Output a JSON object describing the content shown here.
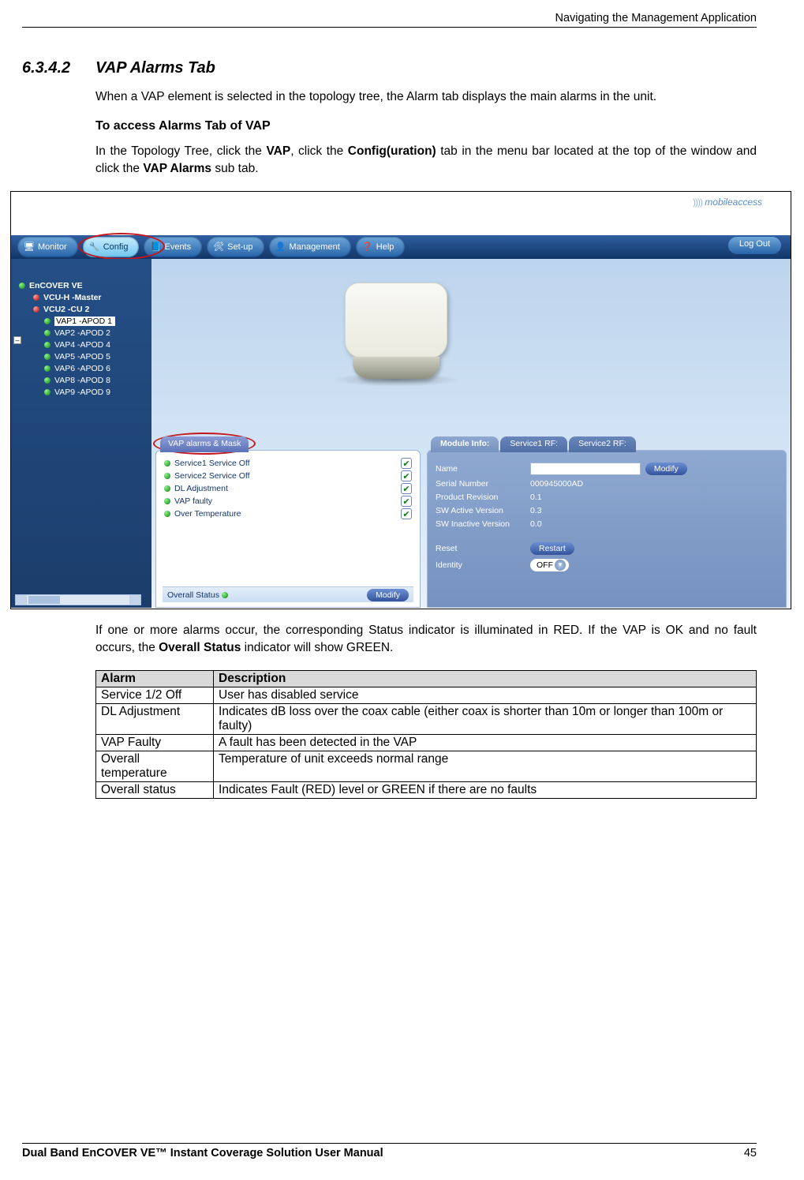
{
  "header": {
    "right": "Navigating the Management Application"
  },
  "sec": {
    "number": "6.3.4.2",
    "title": "VAP Alarms Tab",
    "p1": "When a VAP element is selected in the topology tree, the Alarm tab displays the main alarms in the unit.",
    "h4": "To access Alarms Tab of VAP",
    "p2a": "In the Topology Tree, click the ",
    "p2b": ", click the ",
    "p2c": " tab in the menu bar located at the top of the window and click the ",
    "p2d": " sub tab.",
    "bold1": "VAP",
    "bold2": "Config(uration)",
    "bold3": "VAP Alarms",
    "after1a": "If one or more alarms occur, the corresponding Status indicator is illuminated in RED. If the VAP is OK and no fault occurs, the ",
    "afterbold": "Overall Status",
    "after1b": " indicator will show GREEN."
  },
  "ui": {
    "brand": "mobileaccess",
    "menu": [
      "Monitor",
      "Config",
      "Events",
      "Set-up",
      "Management",
      "Help"
    ],
    "logout": "Log Out",
    "tree": {
      "root": "EnCOVER VE",
      "l1": "VCU-H -Master",
      "l2": "VCU2 -CU 2",
      "vaps": [
        "VAP1 -APOD 1",
        "VAP2 -APOD 2",
        "VAP4 -APOD 4",
        "VAP5 -APOD 5",
        "VAP6 -APOD 6",
        "VAP8 -APOD 8",
        "VAP9 -APOD 9"
      ]
    },
    "alarm_tab": "VAP alarms & Mask",
    "alarms": [
      "Service1 Service Off",
      "Service2 Service Off",
      "DL Adjustment",
      "VAP faulty",
      "Over Temperature"
    ],
    "overall_label": "Overall Status",
    "modify": "Modify",
    "info_tabs": [
      "Module Info:",
      "Service1 RF:",
      "Service2 RF:"
    ],
    "info": {
      "name_k": "Name",
      "sn_k": "Serial Number",
      "sn_v": "000945000AD",
      "pr_k": "Product Revision",
      "pr_v": "0.1",
      "sa_k": "SW Active Version",
      "sa_v": "0.3",
      "si_k": "SW Inactive Version",
      "si_v": "0.0",
      "reset_k": "Reset",
      "restart": "Restart",
      "ident_k": "Identity",
      "ident_v": "OFF"
    }
  },
  "table": {
    "h1": "Alarm",
    "h2": "Description",
    "rows": [
      {
        "a": "Service 1/2 Off",
        "d": "User has disabled service"
      },
      {
        "a": "DL Adjustment",
        "d": "Indicates dB loss over the coax  cable (either coax is shorter than 10m or longer than 100m or faulty)"
      },
      {
        "a": "VAP Faulty",
        "d": "A fault has been detected in the VAP"
      },
      {
        "a": "Overall temperature",
        "d": "Temperature of unit exceeds normal range"
      },
      {
        "a": "Overall status",
        "d": "Indicates Fault (RED) level or GREEN if there are no faults"
      }
    ]
  },
  "footer": {
    "left": "Dual Band EnCOVER VE™ Instant Coverage Solution User Manual",
    "right": "45"
  }
}
